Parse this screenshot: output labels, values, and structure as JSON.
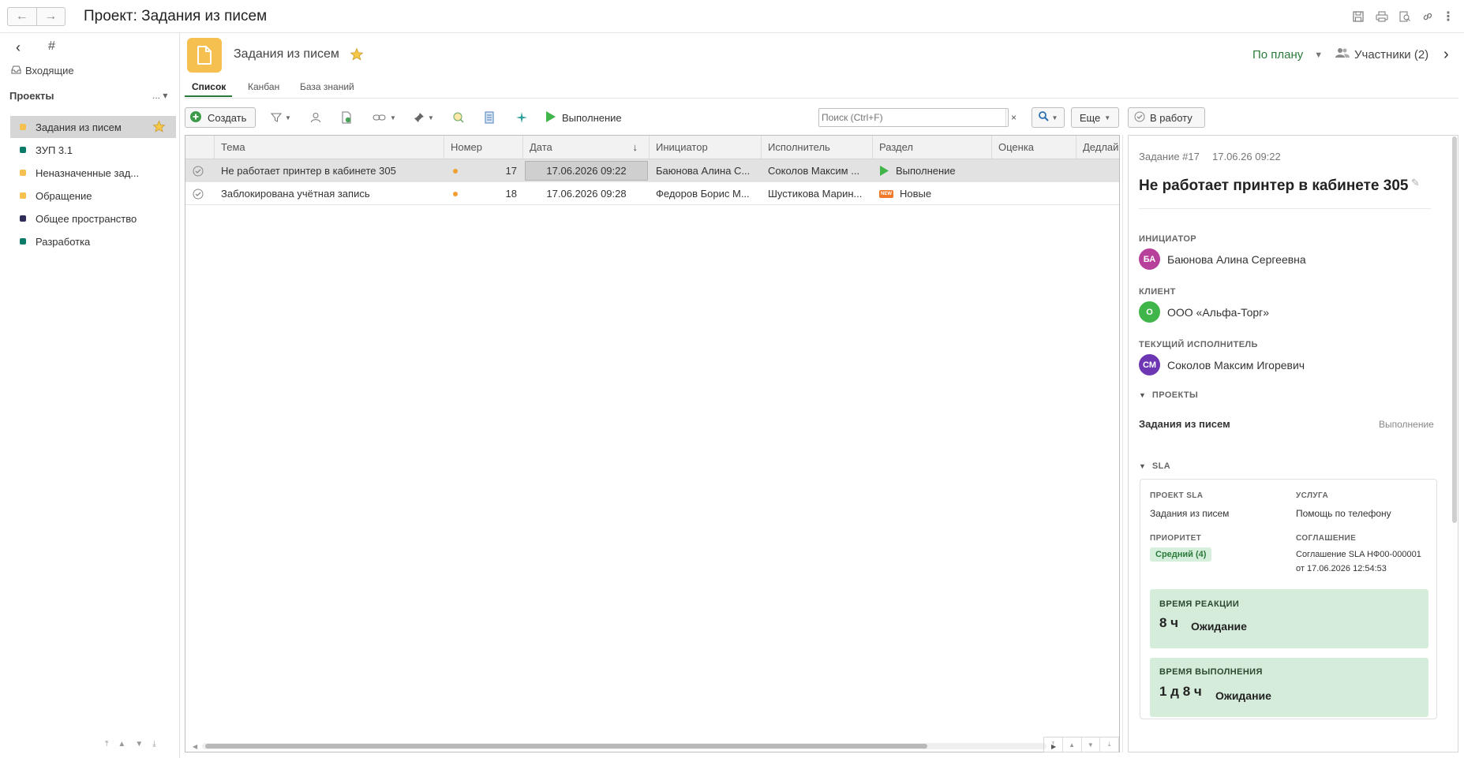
{
  "window": {
    "title": "Проект: Задания из писем"
  },
  "sidebar": {
    "inbox_label": "Входящие",
    "projects_title": "Проекты",
    "projects_more": "...",
    "items": [
      {
        "label": "Задания из писем",
        "color": "#f5c04f",
        "selected": true,
        "starred": true
      },
      {
        "label": "ЗУП 3.1",
        "color": "#0c7a6a"
      },
      {
        "label": "Неназначенные зад...",
        "color": "#f5c04f"
      },
      {
        "label": "Обращение",
        "color": "#f5c04f"
      },
      {
        "label": "Общее пространство",
        "color": "#2e2d5a"
      },
      {
        "label": "Разработка",
        "color": "#0c7a6a"
      }
    ]
  },
  "header": {
    "title": "Задания из писем",
    "plan_label": "По плану",
    "participants_label": "Участники (2)",
    "tabs": [
      "Список",
      "Канбан",
      "База знаний"
    ]
  },
  "toolbar": {
    "create_label": "Создать",
    "execute_label": "Выполнение",
    "search_placeholder": "Поиск (Ctrl+F)",
    "more_label": "Еще",
    "to_work_label": "В работу"
  },
  "grid": {
    "columns": [
      "Тема",
      "Номер",
      "Дата",
      "Инициатор",
      "Исполнитель",
      "Раздел",
      "Оценка",
      "Дедлай"
    ],
    "rows": [
      {
        "subject": "Не работает принтер в кабинете 305",
        "number": "17",
        "date": "17.06.2026 09:22",
        "initiator": "Баюнова Алина С...",
        "executor": "Соколов Максим ...",
        "section": "Выполнение",
        "section_icon": "play-icon",
        "selected": true
      },
      {
        "subject": "Заблокирована учётная запись",
        "number": "18",
        "date": "17.06.2026 09:28",
        "initiator": "Федоров Борис М...",
        "executor": "Шустикова Марин...",
        "section": "Новые",
        "section_icon": "new-badge-icon",
        "badge_text": "NEW"
      }
    ]
  },
  "detail": {
    "task_no": "Задание #17",
    "task_date": "17.06.26 09:22",
    "title": "Не работает принтер в кабинете 305",
    "initiator_label": "ИНИЦИАТОР",
    "initiator": {
      "initials": "БА",
      "name": "Баюнова Алина Сергеевна",
      "color": "#b7409a"
    },
    "client_label": "КЛИЕНТ",
    "client": {
      "initials": "О",
      "name": "ООО «Альфа-Торг»",
      "color": "#3fb54a"
    },
    "executor_label": "ТЕКУЩИЙ ИСПОЛНИТЕЛЬ",
    "executor": {
      "initials": "СМ",
      "name": "Соколов Максим Игоревич",
      "color": "#6d36b3"
    },
    "projects_label": "ПРОЕКТЫ",
    "project_name": "Задания из писем",
    "project_status": "Выполнение",
    "sla_label": "SLA",
    "sla": {
      "project_label": "ПРОЕКТ SLA",
      "project": "Задания из писем",
      "service_label": "УСЛУГА",
      "service": "Помощь по телефону",
      "priority_label": "ПРИОРИТЕТ",
      "priority": "Средний (4)",
      "agreement_label": "СОГЛАШЕНИЕ",
      "agreement_line1": "Соглашение SLA НФ00-000001",
      "agreement_line2": "от 17.06.2026 12:54:53",
      "reaction_label": "ВРЕМЯ РЕАКЦИИ",
      "reaction_value": "8 ч",
      "reaction_status": "Ожидание",
      "execution_label": "ВРЕМЯ ВЫПОЛНЕНИЯ",
      "execution_value": "1 д 8 ч",
      "execution_status": "Ожидание"
    }
  }
}
